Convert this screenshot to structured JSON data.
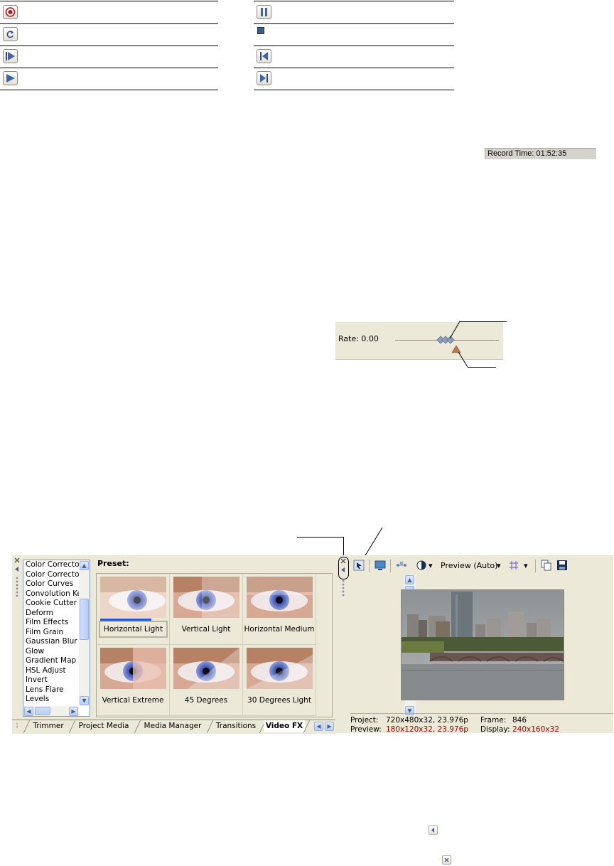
{
  "transport": {
    "left_buttons": [
      "record-icon",
      "loop-icon",
      "play-from-start-icon",
      "play-icon"
    ],
    "right_buttons": [
      "pause-icon",
      "stop-icon",
      "go-to-start-icon",
      "go-to-end-icon"
    ]
  },
  "record_time": "Record Time: 01:52:35",
  "rate": {
    "label": "Rate: 0.00",
    "value": 0.0
  },
  "window": {
    "fx_list": [
      "Color Corrector",
      "Color Corrector",
      "Color Curves",
      "Convolution Kern",
      "Cookie Cutter",
      "Deform",
      "Film Effects",
      "Film Grain",
      "Gaussian Blur",
      "Glow",
      "Gradient Map",
      "HSL Adjust",
      "Invert",
      "Lens Flare",
      "Levels"
    ],
    "preset_label": "Preset:",
    "presets": [
      "Horizontal Light",
      "Vertical Light",
      "Horizontal Medium",
      "Vertical Extreme",
      "45 Degrees",
      "30 Degrees Light"
    ],
    "selected_preset": "Horizontal Light",
    "tabs": [
      "Trimmer",
      "Project Media",
      "Media Manager",
      "Transitions",
      "Video FX"
    ],
    "active_tab": "Video FX",
    "preview_label": "Preview (Auto)",
    "info": {
      "project_label": "Project:",
      "project_value": "720x480x32, 23.976p",
      "frame_label": "Frame:",
      "frame_value": "846",
      "preview_label": "Preview:",
      "preview_value": "180x120x32, 23.976p",
      "display_label": "Display:",
      "display_value": "240x160x32"
    }
  },
  "colors": {
    "accent": "#1f58d6",
    "status_red": "#a00000",
    "panel": "#ece9d8"
  }
}
